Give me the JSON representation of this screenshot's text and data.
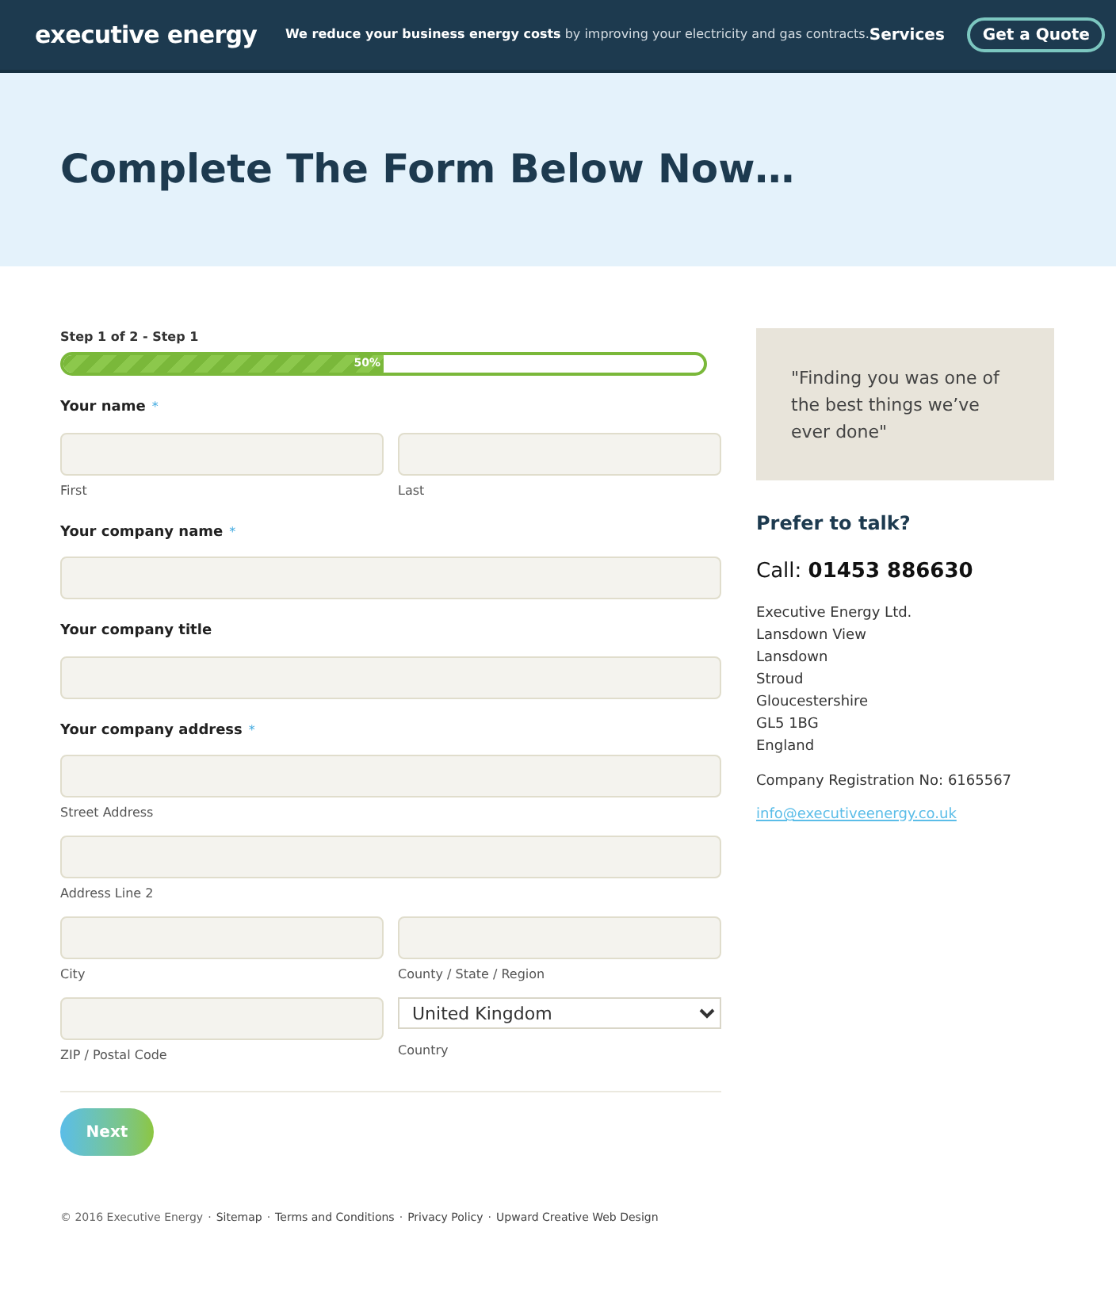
{
  "header": {
    "logo": "executive energy",
    "tagline": "**We reduce your business energy costs** by improving your electricity and gas contracts.",
    "nav": "Services",
    "cta": "Get a Quote"
  },
  "hero": {
    "title": "Complete The Form Below Now…"
  },
  "progress": {
    "step": "Step 1 of 2 - Step 1",
    "level": 0.5,
    "reading": "50%"
  },
  "form": {
    "groups": [
      {
        "label": "Your name",
        "required": true,
        "rows": [
          [
            {
              "kind": "input",
              "sublabel": "First"
            },
            {
              "kind": "input",
              "sublabel": "Last"
            }
          ]
        ]
      },
      {
        "label": "Your company name",
        "required": true,
        "rows": [
          [
            {
              "kind": "input"
            }
          ]
        ]
      },
      {
        "label": "Your company title",
        "required": false,
        "rows": [
          [
            {
              "kind": "input"
            }
          ]
        ]
      },
      {
        "label": "Your company address",
        "required": true,
        "rows": [
          [
            {
              "kind": "input",
              "sublabel": "Street Address"
            }
          ],
          [
            {
              "kind": "input",
              "sublabel": "Address Line 2"
            }
          ],
          [
            {
              "kind": "input",
              "sublabel": "City"
            },
            {
              "kind": "input",
              "sublabel": "County / State / Region"
            }
          ],
          [
            {
              "kind": "input",
              "sublabel": "ZIP / Postal Code"
            },
            {
              "kind": "select",
              "value": "United Kingdom",
              "sublabel": "Country"
            }
          ]
        ]
      }
    ],
    "required_mark": "*",
    "next": "Next"
  },
  "sidebar": {
    "quote": "\"Finding you was one of the best things we’ve ever done\"",
    "talk_heading": "Prefer to talk?",
    "call_label": "Call:",
    "phone": "01453 886630",
    "address": [
      "Executive Energy Ltd.",
      "Lansdown View",
      "Lansdown",
      "Stroud",
      "Gloucestershire",
      "GL5 1BG",
      "England"
    ],
    "registration": "Company Registration No: 6165567",
    "email": "info@executiveenergy.co.uk"
  },
  "footer": [
    {
      "kind": "text",
      "text": "© 2016 Executive Energy"
    },
    {
      "kind": "sep",
      "text": "·"
    },
    {
      "kind": "link",
      "text": "Sitemap"
    },
    {
      "kind": "sep",
      "text": "·"
    },
    {
      "kind": "link",
      "text": "Terms and Conditions"
    },
    {
      "kind": "sep",
      "text": "·"
    },
    {
      "kind": "link",
      "text": "Privacy Policy"
    },
    {
      "kind": "sep",
      "text": "·"
    },
    {
      "kind": "link",
      "text": "Upward Creative Web Design"
    }
  ]
}
